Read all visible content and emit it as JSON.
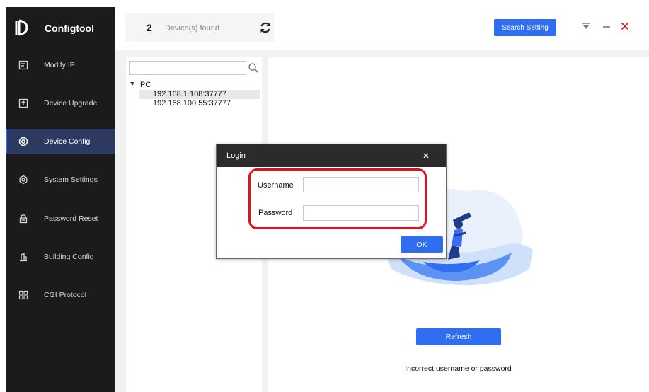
{
  "app": {
    "name": "Configtool"
  },
  "sidebar": {
    "items": [
      {
        "label": "Modify IP",
        "icon": "modify-ip-icon"
      },
      {
        "label": "Device Upgrade",
        "icon": "upgrade-icon"
      },
      {
        "label": "Device Config",
        "icon": "device-config-icon",
        "active": true
      },
      {
        "label": "System Settings",
        "icon": "system-settings-icon"
      },
      {
        "label": "Password Reset",
        "icon": "password-reset-icon"
      },
      {
        "label": "Building Config",
        "icon": "building-config-icon"
      },
      {
        "label": "CGI Protocol",
        "icon": "cgi-protocol-icon"
      }
    ]
  },
  "topbar": {
    "device_count": "2",
    "device_count_label": "Device(s) found",
    "search_setting_label": "Search Setting"
  },
  "tree": {
    "search_value": "",
    "root_label": "IPC",
    "items": [
      "192.168.1.108:37777",
      "192.168.100.55:37777"
    ],
    "selected_index": 0
  },
  "main": {
    "refresh_label": "Refresh",
    "error_message": "Incorrect username or password"
  },
  "dialog": {
    "title": "Login",
    "username_label": "Username",
    "username_value": "",
    "password_label": "Password",
    "password_value": "",
    "ok_label": "OK"
  },
  "colors": {
    "sidebar_bg": "#1b1b1b",
    "sidebar_active": "#2b3a5e",
    "accent_blue": "#2f6ef0",
    "close_red": "#e0101c",
    "highlight_red": "#e0101c"
  }
}
